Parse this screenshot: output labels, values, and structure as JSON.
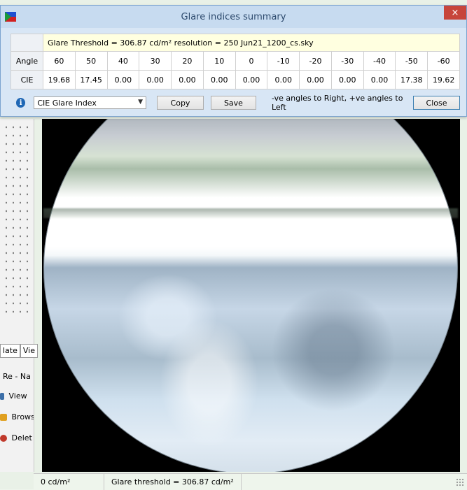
{
  "dialog": {
    "title": "Glare indices summary",
    "close_glyph": "×",
    "info_line": "Glare Threshold = 306.87 cd/m²    resolution = 250    Jun21_1200_cs.sky",
    "table": {
      "angle_label": "Angle",
      "cie_label": "CIE",
      "angles": [
        "60",
        "50",
        "40",
        "30",
        "20",
        "10",
        "0",
        "-10",
        "-20",
        "-30",
        "-40",
        "-50",
        "-60"
      ],
      "cie_values": [
        "19.68",
        "17.45",
        "0.00",
        "0.00",
        "0.00",
        "0.00",
        "0.00",
        "0.00",
        "0.00",
        "0.00",
        "0.00",
        "17.38",
        "19.62"
      ]
    },
    "controls": {
      "info_icon": "info-icon",
      "select_value": "CIE Glare Index",
      "copy_label": "Copy",
      "save_label": "Save",
      "hint": "-ve angles to Right, +ve angles to Left",
      "close_label": "Close"
    }
  },
  "background_app": {
    "tabs": [
      "late",
      "Vie"
    ],
    "items": [
      "Re - Na",
      "View",
      "Brows",
      "Delet"
    ]
  },
  "statusbar": {
    "left": "0 cd/m²",
    "right": "Glare threshold =  306.87 cd/m²"
  },
  "colors": {
    "title_bg": "#c7dbf0",
    "close_red": "#c7453b",
    "info_row_bg": "#ffffe0"
  }
}
